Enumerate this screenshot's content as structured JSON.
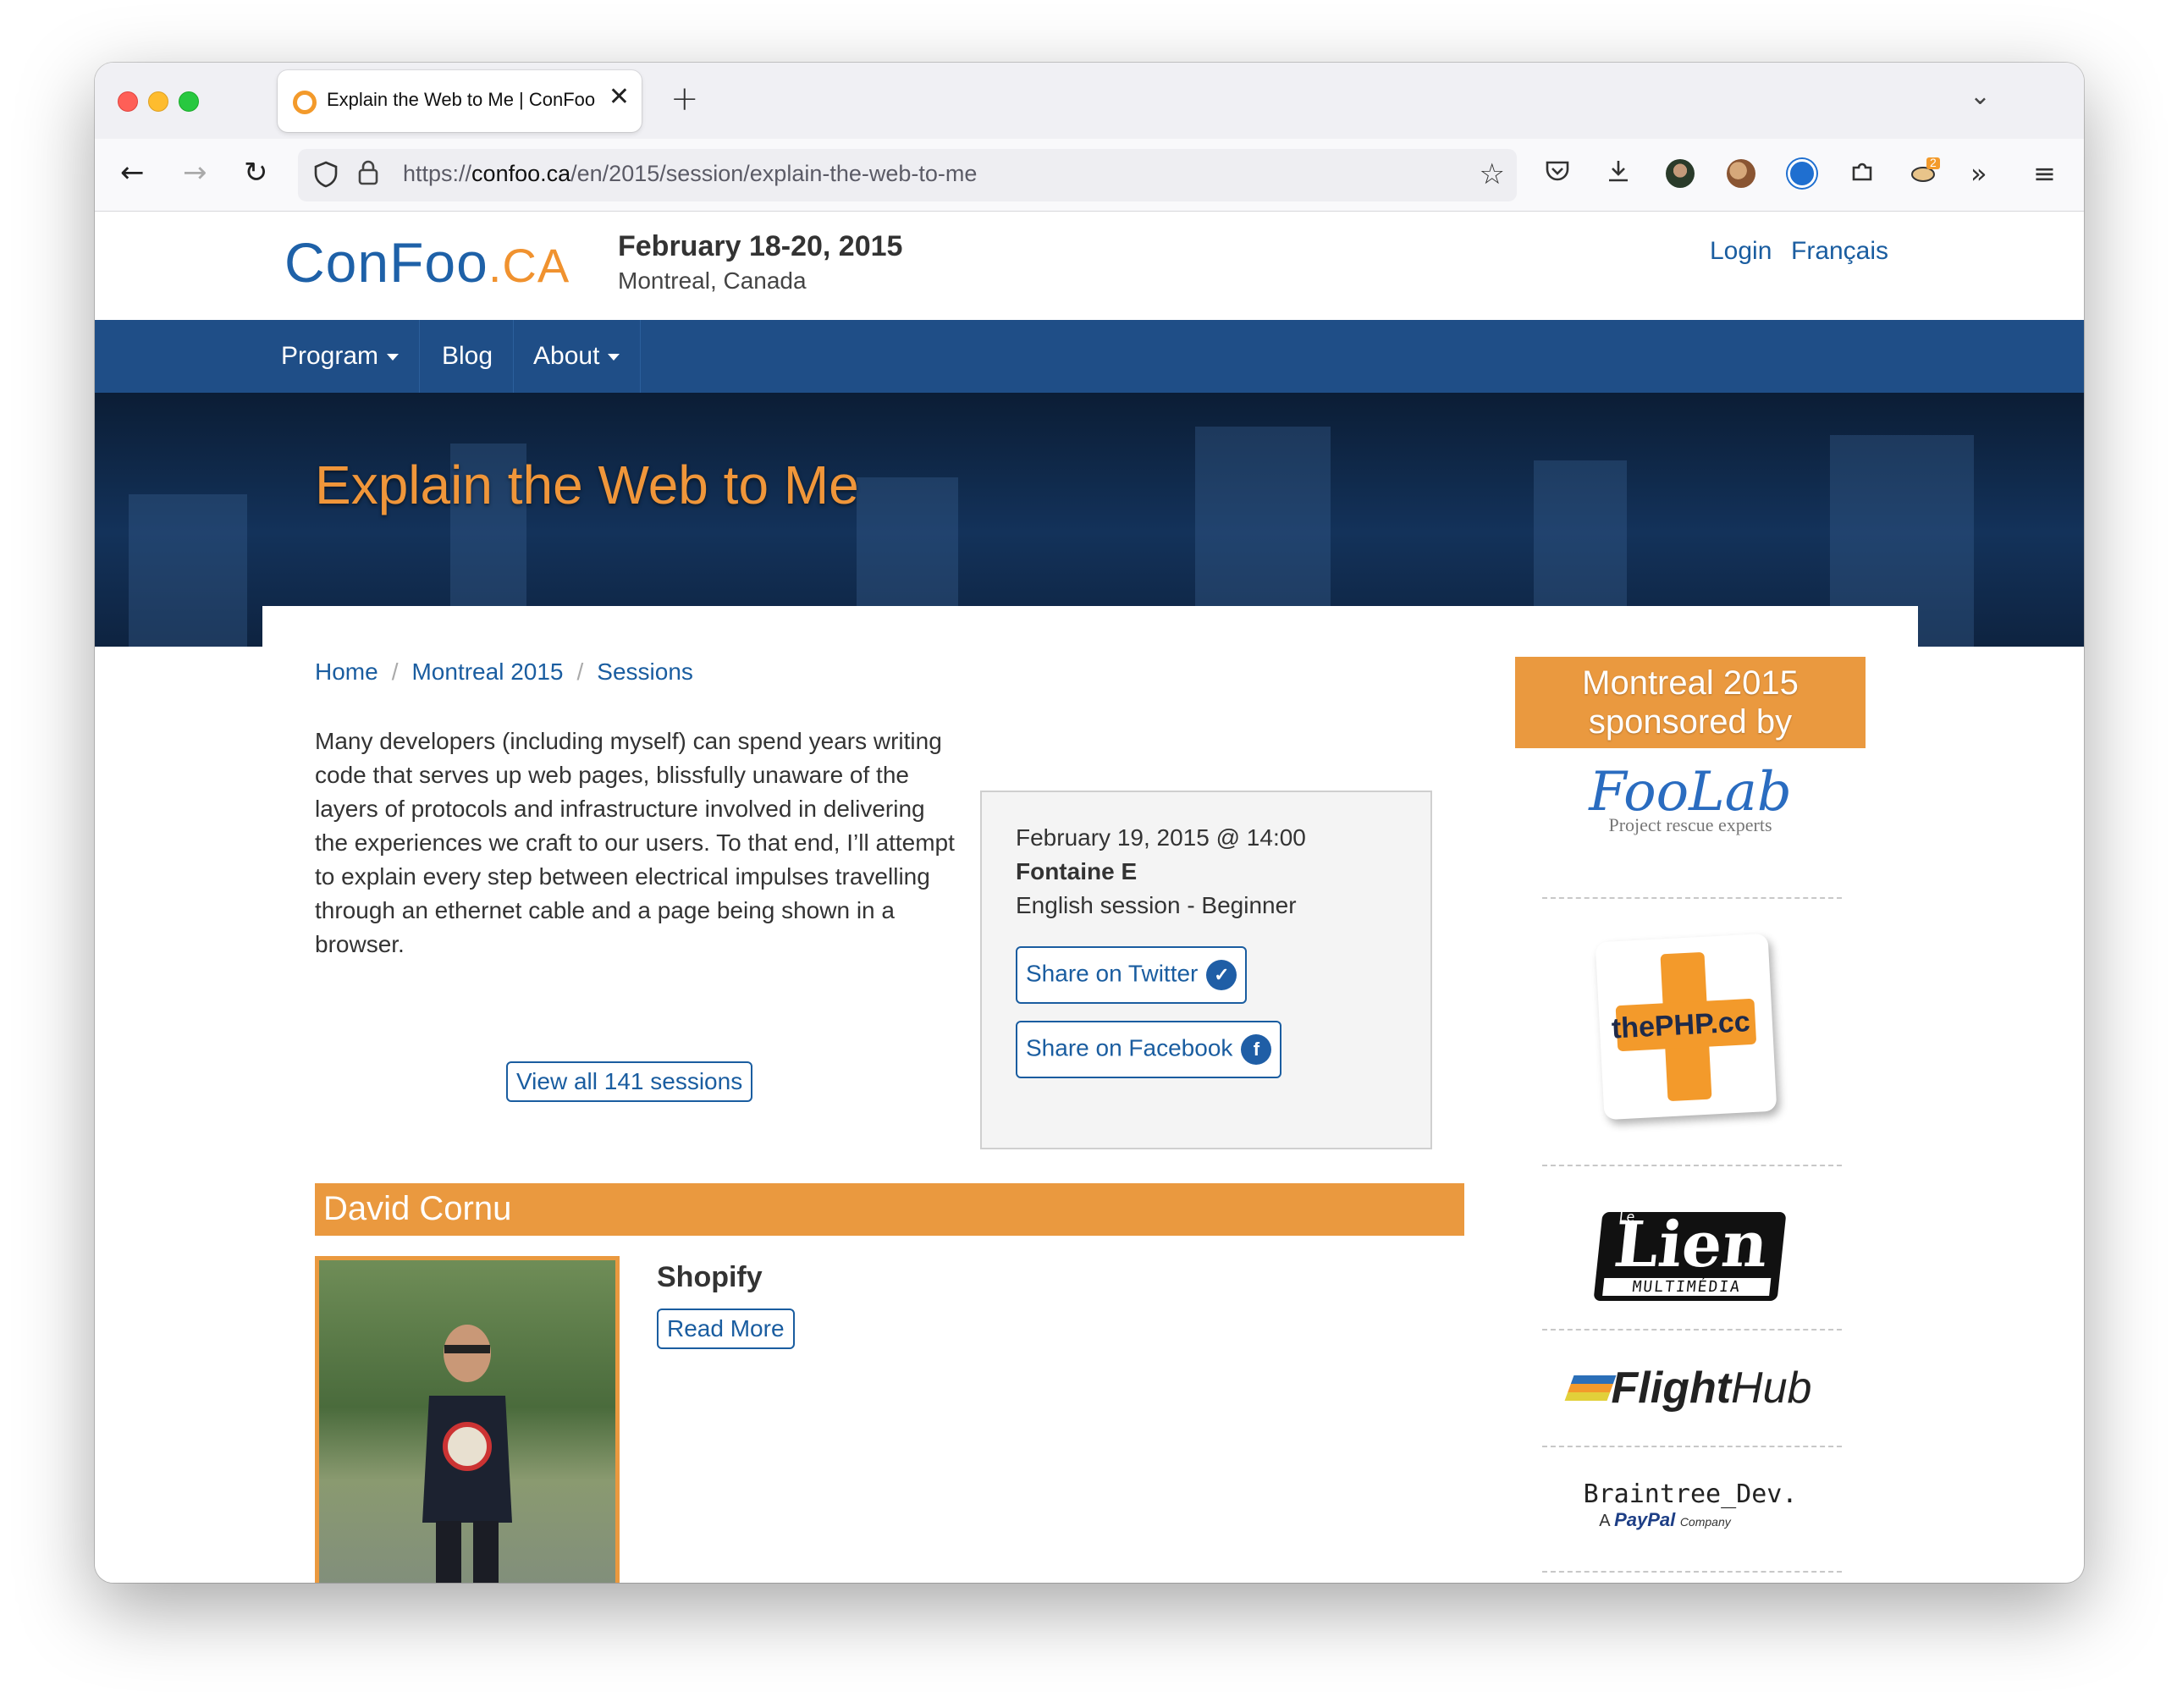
{
  "browser": {
    "tab_title": "Explain the Web to Me | ConFoo",
    "tab_close": "✕",
    "new_tab": "+",
    "url_prefix": "https://",
    "url_domain": "confoo.ca",
    "url_path": "/en/2015/session/explain-the-web-to-me",
    "extension_badge": "2"
  },
  "header": {
    "logo_main": "ConFoo",
    "logo_suffix": ".CA",
    "date": "February 18-20, 2015",
    "location": "Montreal, Canada",
    "login": "Login",
    "language": "Français"
  },
  "nav": {
    "program": "Program",
    "blog": "Blog",
    "about": "About"
  },
  "hero": {
    "title": "Explain the Web to Me"
  },
  "breadcrumb": {
    "home": "Home",
    "event": "Montreal 2015",
    "sessions": "Sessions",
    "separator": "/"
  },
  "session": {
    "description": "Many developers (including myself) can spend years writing code that serves up web pages, blissfully unaware of the layers of protocols and infrastructure involved in delivering the experiences we craft to our users. To that end, I’ll attempt to explain every step between electrical impulses travelling through an ethernet cable and a page being shown in a browser.",
    "view_all": "View all 141 sessions",
    "datetime": "February 19, 2015 @ 14:00",
    "room": "Fontaine E",
    "language_level": "English session - Beginner",
    "share_twitter": "Share on Twitter",
    "share_facebook": "Share on Facebook"
  },
  "speaker": {
    "name": "David Cornu",
    "company": "Shopify",
    "read_more": "Read More"
  },
  "sponsors": {
    "heading": "Montreal 2015 sponsored by",
    "foolab_name": "FooLab",
    "foolab_tagline": "Project rescue experts",
    "thephp": "thePHP.cc",
    "lien_main": "Lien",
    "lien_sub": "MULTIMÉDIA",
    "lien_le": "Le",
    "flighthub_a": "Flight",
    "flighthub_b": "Hub",
    "braintree": "Braintree_Dev.",
    "braintree_sub_a": "A",
    "braintree_sub_b": "PayPal",
    "braintree_sub_c": "Company"
  },
  "colors": {
    "brand_blue": "#1f4e87",
    "accent_orange": "#ea993f",
    "link_blue": "#1a5da0"
  }
}
